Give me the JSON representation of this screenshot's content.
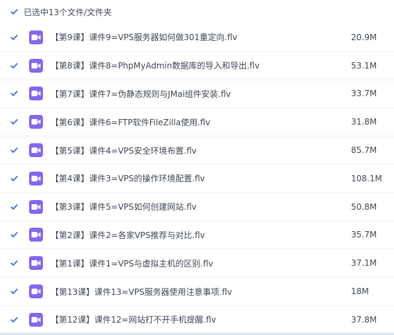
{
  "header": {
    "selection_summary": "已选中13个文件/文件夹"
  },
  "colors": {
    "accent": "#3b6fd8",
    "file_icon": "#8566ee",
    "divider": "#eef1f7"
  },
  "files": [
    {
      "name": "【第9课】课件9=VPS服务器如何做301重定向.flv",
      "size": "20.9M",
      "icon": "video-file-icon",
      "checked": true
    },
    {
      "name": "【第8课】课件8=PhpMyAdmin数据库的导入和导出.flv",
      "size": "53.1M",
      "icon": "video-file-icon",
      "checked": true
    },
    {
      "name": "【第7课】课件7=伪静态规则与JMai组件安装.flv",
      "size": "33.7M",
      "icon": "video-file-icon",
      "checked": true
    },
    {
      "name": "【第6课】课件6=FTP软件FileZilla使用.flv",
      "size": "31.8M",
      "icon": "video-file-icon",
      "checked": true
    },
    {
      "name": "【第5课】课件4=VPS安全环境布置.flv",
      "size": "85.7M",
      "icon": "video-file-icon",
      "checked": true
    },
    {
      "name": "【第4课】课件3=VPS的操作环境配置.flv",
      "size": "108.1M",
      "icon": "video-file-icon",
      "checked": true
    },
    {
      "name": "【第3课】课件5=VPS如何创建网站.flv",
      "size": "50.8M",
      "icon": "video-file-icon",
      "checked": true
    },
    {
      "name": "【第2课】课件2=各家VPS推荐与对比.flv",
      "size": "35.7M",
      "icon": "video-file-icon",
      "checked": true
    },
    {
      "name": "【第1课】课件1=VPS与虚拟主机的区别.flv",
      "size": "37.1M",
      "icon": "video-file-icon",
      "checked": true
    },
    {
      "name": "【第13课】课件13=VPS服务器使用注意事项.flv",
      "size": "18M",
      "icon": "video-file-icon",
      "checked": true
    },
    {
      "name": "【第12课】课件12=网站打不开手机提醒.flv",
      "size": "37.8M",
      "icon": "video-file-icon",
      "checked": true
    }
  ]
}
